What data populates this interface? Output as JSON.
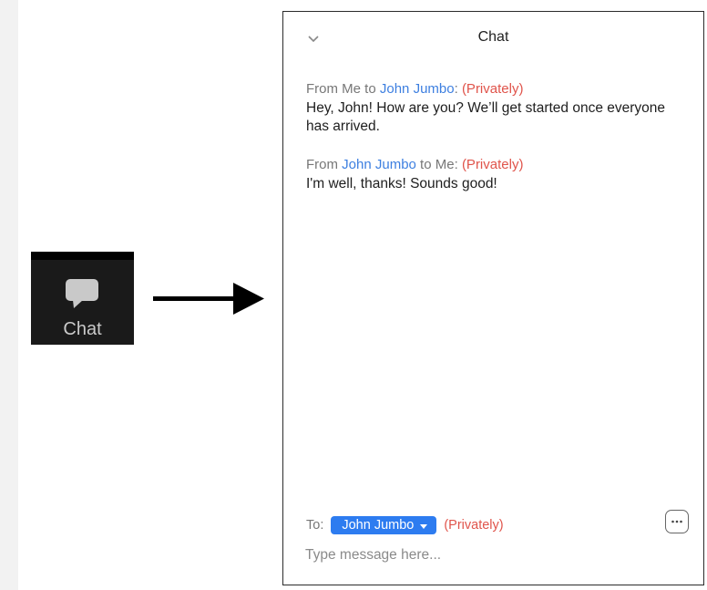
{
  "toolbar": {
    "chat_label": "Chat",
    "chat_icon": "speech-bubble-icon"
  },
  "arrow_icon": "right-arrow-icon",
  "chat_panel": {
    "title": "Chat",
    "collapse_icon": "chevron-down-icon",
    "messages": [
      {
        "from_prefix": "From ",
        "from": "Me",
        "to_word": " to ",
        "to": "John Jumbo",
        "separator": ": ",
        "privacy": "(Privately)",
        "text": "Hey, John! How are you? We’ll get started once everyone has arrived."
      },
      {
        "from_prefix": "From ",
        "from": "John Jumbo",
        "to_word": " to ",
        "to": "Me",
        "separator": ": ",
        "privacy": "(Privately)",
        "text": "I'm well, thanks! Sounds good!"
      }
    ],
    "recipient_label": "To:",
    "recipient": "John Jumbo",
    "recipient_privacy": "(Privately)",
    "more_icon": "ellipsis-icon",
    "input_placeholder": "Type message here..."
  },
  "colors": {
    "link_blue": "#3d7fe0",
    "private_red": "#e0544b",
    "recipient_bg": "#2d7cf0",
    "toolbar_bg": "#1a1a1a"
  }
}
